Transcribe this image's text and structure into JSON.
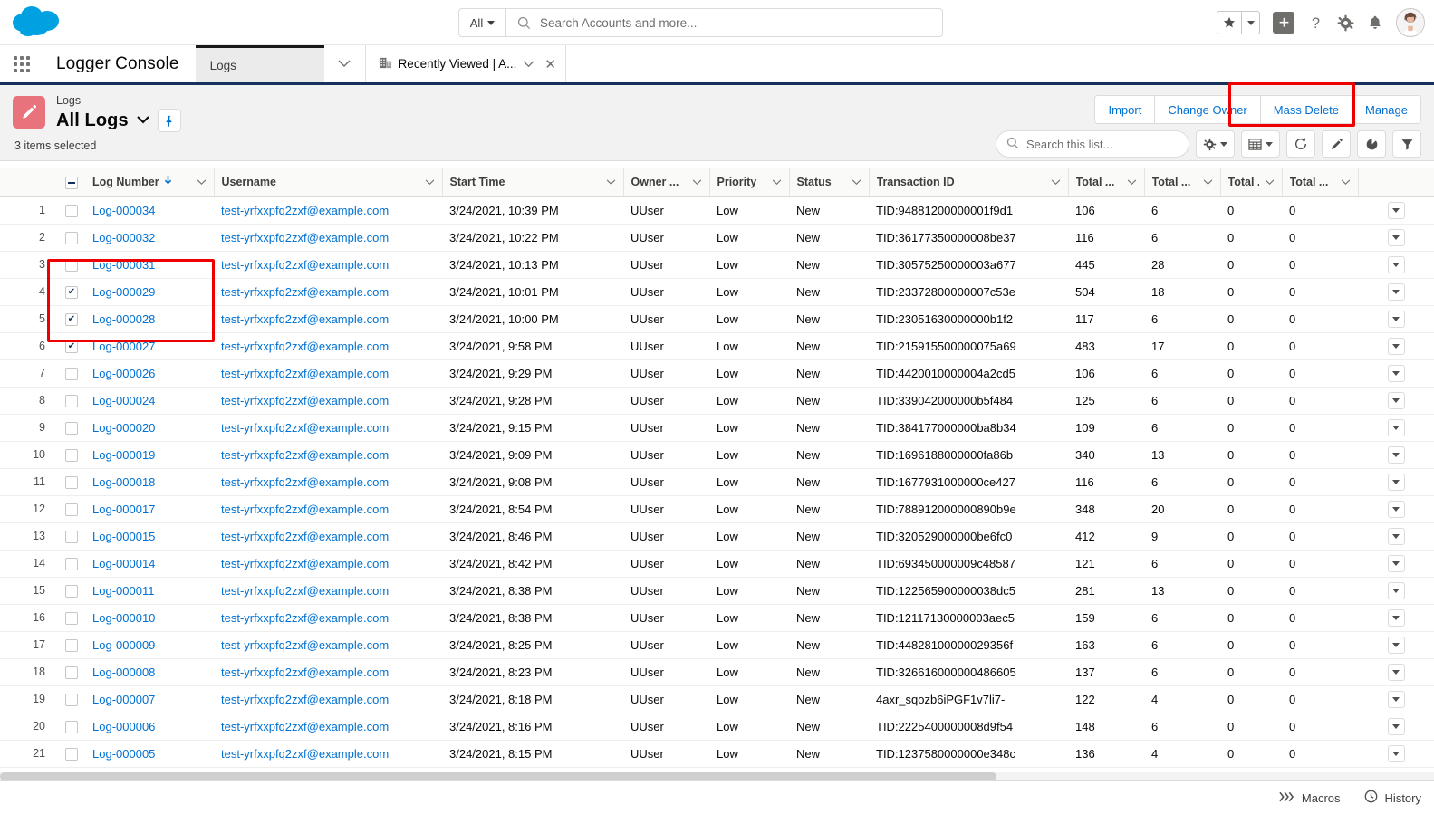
{
  "global_header": {
    "logo": "salesforce-cloud",
    "search": {
      "scope": "All",
      "placeholder": "Search Accounts and more..."
    },
    "icons": [
      "favorites-star-icon",
      "favorites-dropdown-icon",
      "global-add-icon",
      "help-icon",
      "setup-gear-icon",
      "notifications-bell-icon",
      "user-avatar"
    ]
  },
  "app_nav": {
    "app_launcher": "app-launcher-icon",
    "app_name": "Logger Console",
    "console_tab": {
      "label": "Logs"
    },
    "sub_tab": {
      "label": "Recently Viewed | A...",
      "icon": "account-object-icon"
    }
  },
  "list_view": {
    "object_label": "Logs",
    "name": "All Logs",
    "selected_count": "3 items selected",
    "actions": [
      {
        "label": "Import",
        "highlighted": false
      },
      {
        "label": "Change Owner",
        "highlighted": false
      },
      {
        "label": "Mass Delete",
        "highlighted": true
      },
      {
        "label": "Manage",
        "highlighted": false
      }
    ],
    "search_placeholder": "Search this list...",
    "tools": [
      "list-view-controls-gear-icon",
      "display-as-table-icon",
      "refresh-icon",
      "edit-pencil-icon",
      "charts-icon",
      "filter-icon"
    ]
  },
  "table": {
    "columns": [
      {
        "label": "Log Number",
        "sorted": true,
        "sort_dir": "asc"
      },
      {
        "label": "Username"
      },
      {
        "label": "Start Time"
      },
      {
        "label": "Owner ..."
      },
      {
        "label": "Priority"
      },
      {
        "label": "Status"
      },
      {
        "label": "Transaction ID"
      },
      {
        "label": "Total ..."
      },
      {
        "label": "Total ..."
      },
      {
        "label": "Total ..."
      },
      {
        "label": "Total ..."
      }
    ],
    "rows": [
      {
        "n": "1",
        "selected": false,
        "log_number": "Log-000034",
        "username": "test-yrfxxpfq2zxf@example.com",
        "start_time": "3/24/2021, 10:39 PM",
        "owner": "UUser",
        "priority": "Low",
        "status": "New",
        "transaction_id": "TID:94881200000001f9d1",
        "t1": "106",
        "t2": "6",
        "t3": "0",
        "t4": "0"
      },
      {
        "n": "2",
        "selected": false,
        "log_number": "Log-000032",
        "username": "test-yrfxxpfq2zxf@example.com",
        "start_time": "3/24/2021, 10:22 PM",
        "owner": "UUser",
        "priority": "Low",
        "status": "New",
        "transaction_id": "TID:36177350000008be37",
        "t1": "116",
        "t2": "6",
        "t3": "0",
        "t4": "0"
      },
      {
        "n": "3",
        "selected": false,
        "log_number": "Log-000031",
        "username": "test-yrfxxpfq2zxf@example.com",
        "start_time": "3/24/2021, 10:13 PM",
        "owner": "UUser",
        "priority": "Low",
        "status": "New",
        "transaction_id": "TID:30575250000003a677",
        "t1": "445",
        "t2": "28",
        "t3": "0",
        "t4": "0"
      },
      {
        "n": "4",
        "selected": true,
        "log_number": "Log-000029",
        "username": "test-yrfxxpfq2zxf@example.com",
        "start_time": "3/24/2021, 10:01 PM",
        "owner": "UUser",
        "priority": "Low",
        "status": "New",
        "transaction_id": "TID:23372800000007c53e",
        "t1": "504",
        "t2": "18",
        "t3": "0",
        "t4": "0"
      },
      {
        "n": "5",
        "selected": true,
        "log_number": "Log-000028",
        "username": "test-yrfxxpfq2zxf@example.com",
        "start_time": "3/24/2021, 10:00 PM",
        "owner": "UUser",
        "priority": "Low",
        "status": "New",
        "transaction_id": "TID:23051630000000b1f2",
        "t1": "117",
        "t2": "6",
        "t3": "0",
        "t4": "0"
      },
      {
        "n": "6",
        "selected": true,
        "log_number": "Log-000027",
        "username": "test-yrfxxpfq2zxf@example.com",
        "start_time": "3/24/2021, 9:58 PM",
        "owner": "UUser",
        "priority": "Low",
        "status": "New",
        "transaction_id": "TID:215915500000075a69",
        "t1": "483",
        "t2": "17",
        "t3": "0",
        "t4": "0"
      },
      {
        "n": "7",
        "selected": false,
        "log_number": "Log-000026",
        "username": "test-yrfxxpfq2zxf@example.com",
        "start_time": "3/24/2021, 9:29 PM",
        "owner": "UUser",
        "priority": "Low",
        "status": "New",
        "transaction_id": "TID:4420010000004a2cd5",
        "t1": "106",
        "t2": "6",
        "t3": "0",
        "t4": "0"
      },
      {
        "n": "8",
        "selected": false,
        "log_number": "Log-000024",
        "username": "test-yrfxxpfq2zxf@example.com",
        "start_time": "3/24/2021, 9:28 PM",
        "owner": "UUser",
        "priority": "Low",
        "status": "New",
        "transaction_id": "TID:339042000000b5f484",
        "t1": "125",
        "t2": "6",
        "t3": "0",
        "t4": "0"
      },
      {
        "n": "9",
        "selected": false,
        "log_number": "Log-000020",
        "username": "test-yrfxxpfq2zxf@example.com",
        "start_time": "3/24/2021, 9:15 PM",
        "owner": "UUser",
        "priority": "Low",
        "status": "New",
        "transaction_id": "TID:384177000000ba8b34",
        "t1": "109",
        "t2": "6",
        "t3": "0",
        "t4": "0"
      },
      {
        "n": "10",
        "selected": false,
        "log_number": "Log-000019",
        "username": "test-yrfxxpfq2zxf@example.com",
        "start_time": "3/24/2021, 9:09 PM",
        "owner": "UUser",
        "priority": "Low",
        "status": "New",
        "transaction_id": "TID:1696188000000fa86b",
        "t1": "340",
        "t2": "13",
        "t3": "0",
        "t4": "0"
      },
      {
        "n": "11",
        "selected": false,
        "log_number": "Log-000018",
        "username": "test-yrfxxpfq2zxf@example.com",
        "start_time": "3/24/2021, 9:08 PM",
        "owner": "UUser",
        "priority": "Low",
        "status": "New",
        "transaction_id": "TID:1677931000000ce427",
        "t1": "116",
        "t2": "6",
        "t3": "0",
        "t4": "0"
      },
      {
        "n": "12",
        "selected": false,
        "log_number": "Log-000017",
        "username": "test-yrfxxpfq2zxf@example.com",
        "start_time": "3/24/2021, 8:54 PM",
        "owner": "UUser",
        "priority": "Low",
        "status": "New",
        "transaction_id": "TID:788912000000890b9e",
        "t1": "348",
        "t2": "20",
        "t3": "0",
        "t4": "0"
      },
      {
        "n": "13",
        "selected": false,
        "log_number": "Log-000015",
        "username": "test-yrfxxpfq2zxf@example.com",
        "start_time": "3/24/2021, 8:46 PM",
        "owner": "UUser",
        "priority": "Low",
        "status": "New",
        "transaction_id": "TID:320529000000be6fc0",
        "t1": "412",
        "t2": "9",
        "t3": "0",
        "t4": "0"
      },
      {
        "n": "14",
        "selected": false,
        "log_number": "Log-000014",
        "username": "test-yrfxxpfq2zxf@example.com",
        "start_time": "3/24/2021, 8:42 PM",
        "owner": "UUser",
        "priority": "Low",
        "status": "New",
        "transaction_id": "TID:693450000009c48587",
        "t1": "121",
        "t2": "6",
        "t3": "0",
        "t4": "0"
      },
      {
        "n": "15",
        "selected": false,
        "log_number": "Log-000011",
        "username": "test-yrfxxpfq2zxf@example.com",
        "start_time": "3/24/2021, 8:38 PM",
        "owner": "UUser",
        "priority": "Low",
        "status": "New",
        "transaction_id": "TID:122565900000038dc5",
        "t1": "281",
        "t2": "13",
        "t3": "0",
        "t4": "0"
      },
      {
        "n": "16",
        "selected": false,
        "log_number": "Log-000010",
        "username": "test-yrfxxpfq2zxf@example.com",
        "start_time": "3/24/2021, 8:38 PM",
        "owner": "UUser",
        "priority": "Low",
        "status": "New",
        "transaction_id": "TID:12117130000003aec5",
        "t1": "159",
        "t2": "6",
        "t3": "0",
        "t4": "0"
      },
      {
        "n": "17",
        "selected": false,
        "log_number": "Log-000009",
        "username": "test-yrfxxpfq2zxf@example.com",
        "start_time": "3/24/2021, 8:25 PM",
        "owner": "UUser",
        "priority": "Low",
        "status": "New",
        "transaction_id": "TID:44828100000029356f",
        "t1": "163",
        "t2": "6",
        "t3": "0",
        "t4": "0"
      },
      {
        "n": "18",
        "selected": false,
        "log_number": "Log-000008",
        "username": "test-yrfxxpfq2zxf@example.com",
        "start_time": "3/24/2021, 8:23 PM",
        "owner": "UUser",
        "priority": "Low",
        "status": "New",
        "transaction_id": "TID:326616000000486605",
        "t1": "137",
        "t2": "6",
        "t3": "0",
        "t4": "0"
      },
      {
        "n": "19",
        "selected": false,
        "log_number": "Log-000007",
        "username": "test-yrfxxpfq2zxf@example.com",
        "start_time": "3/24/2021, 8:18 PM",
        "owner": "UUser",
        "priority": "Low",
        "status": "New",
        "transaction_id": "4axr_sqozb6iPGF1v7li7-",
        "t1": "122",
        "t2": "4",
        "t3": "0",
        "t4": "0"
      },
      {
        "n": "20",
        "selected": false,
        "log_number": "Log-000006",
        "username": "test-yrfxxpfq2zxf@example.com",
        "start_time": "3/24/2021, 8:16 PM",
        "owner": "UUser",
        "priority": "Low",
        "status": "New",
        "transaction_id": "TID:2225400000008d9f54",
        "t1": "148",
        "t2": "6",
        "t3": "0",
        "t4": "0"
      },
      {
        "n": "21",
        "selected": false,
        "log_number": "Log-000005",
        "username": "test-yrfxxpfq2zxf@example.com",
        "start_time": "3/24/2021, 8:15 PM",
        "owner": "UUser",
        "priority": "Low",
        "status": "New",
        "transaction_id": "TID:1237580000000e348c",
        "t1": "136",
        "t2": "4",
        "t3": "0",
        "t4": "0"
      }
    ]
  },
  "utility_bar": {
    "items": [
      {
        "label": "Macros",
        "icon": "macros-chevrons-icon"
      },
      {
        "label": "History",
        "icon": "history-clock-icon"
      }
    ]
  },
  "colors": {
    "link": "#0070d2",
    "highlight_box": "#ee0000",
    "object_icon_bg": "#e8737d",
    "nav_underline": "#16325c",
    "header_bg": "#f3f2f2"
  }
}
